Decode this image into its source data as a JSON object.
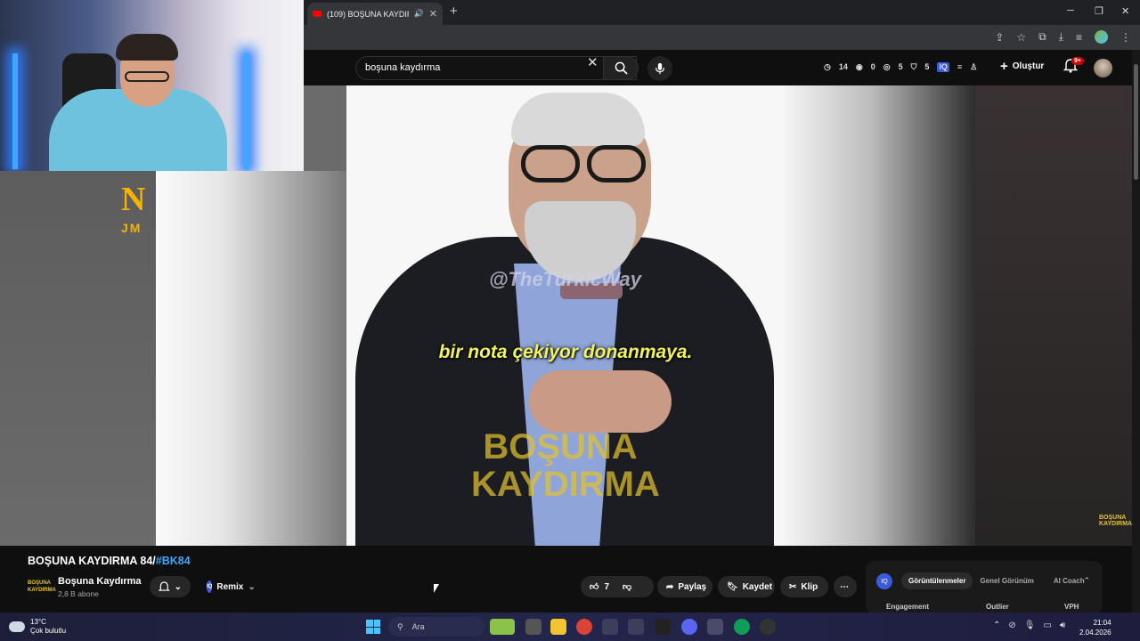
{
  "browser": {
    "tab_title": "(109) BOŞUNA KAYDIRMA",
    "window_controls": [
      "─",
      "❐",
      "✕"
    ]
  },
  "youtube": {
    "search_value": "boşuna kaydırma",
    "stats": [
      "14",
      "0",
      "5",
      "5"
    ],
    "create_label": "Oluştur",
    "notification_count": "9+"
  },
  "video": {
    "watermark": "@TheTurkicWay",
    "subtitle": "bir nota çekiyor donanmaya.",
    "logo_line1": "BOŞUNA",
    "logo_line2": "KAYDIRMA",
    "corner_logo": "BOŞUNA KAYDIRMA",
    "side_logo_big": "N",
    "side_logo_small": "JM"
  },
  "below_video": {
    "title_main": "BOŞUNA KAYDIRMA 84/",
    "title_tag": "#BK84",
    "channel_logo_text": "BOŞUNA KAYDIRMA",
    "channel_name": "Boşuna Kaydırma",
    "subscribers": "2,8 B abone",
    "remix_label": "Remix",
    "iq_label": "IQ",
    "like_count": "7",
    "share_label": "Paylaş",
    "save_label": "Kaydet",
    "clip_label": "Klip",
    "panel_tabs": [
      "Görüntülenmeler",
      "Genel Görünüm",
      "AI Coach"
    ],
    "panel_columns": [
      "Engagement",
      "Outlier",
      "VPH"
    ]
  },
  "taskbar": {
    "temperature": "13°C",
    "weather": "Çok bulutlu",
    "search_placeholder": "Ara",
    "time": "21:04",
    "date": "2.04.2026"
  }
}
